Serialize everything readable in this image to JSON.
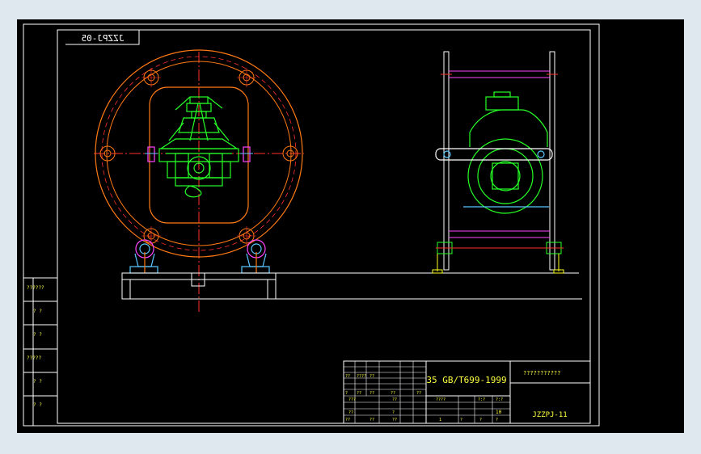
{
  "colors": {
    "frame": "#ffffff",
    "orange": "#ff7a14",
    "green": "#26ff26",
    "cyan": "#5ac8ff",
    "magenta": "#ff44ff",
    "red": "#ff3030",
    "yellow": "#ffff20",
    "background": "#000000"
  },
  "drawing": {
    "mirrored_code": "JZZPJ-05",
    "title_block": {
      "material": "35 GB/T699-1999",
      "drawing_no": "JZZPJ-11",
      "name_placeholder": "???????????",
      "small_cells": [
        "??",
        "????",
        "??",
        "?",
        "??",
        "??",
        "??",
        "???",
        "??",
        "??",
        "?",
        "??",
        "????",
        "?:?",
        "?:?",
        "10",
        "1",
        "?",
        "?",
        "?"
      ],
      "marks_left": [
        "??",
        "??",
        "??"
      ]
    },
    "side_labels": [
      "??????",
      "? ?",
      "? ?",
      "?????",
      "? ?",
      "? ?"
    ]
  },
  "icons": {
    "centre_marks": "crosshair-icon",
    "bolt_holes": "bolt-circle-icon"
  }
}
